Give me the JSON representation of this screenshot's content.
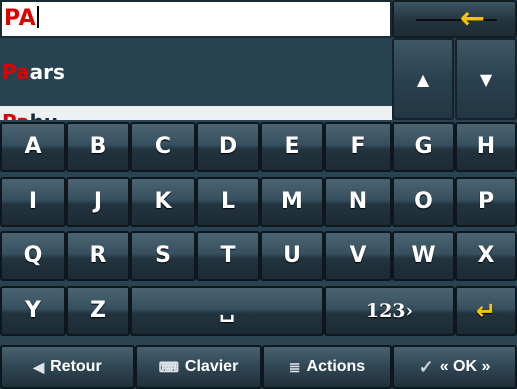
{
  "search": {
    "value": "PA"
  },
  "back_icon": "left-arrow-icon",
  "list": {
    "items": [
      {
        "match": "Pa",
        "rest": "ars",
        "selected": true
      },
      {
        "match": "Pa",
        "rest": "hu",
        "selected": false
      }
    ]
  },
  "nav": {
    "up": "▲",
    "down": "▼"
  },
  "keys": {
    "row1": [
      "A",
      "B",
      "C",
      "D",
      "E",
      "F",
      "G",
      "H"
    ],
    "row2": [
      "I",
      "J",
      "K",
      "L",
      "M",
      "N",
      "O",
      "P"
    ],
    "row3": [
      "Q",
      "R",
      "S",
      "T",
      "U",
      "V",
      "W",
      "X"
    ],
    "row4": [
      "Y",
      "Z"
    ],
    "space_icon": "␣",
    "numbers": "123›",
    "enter_icon": "↵"
  },
  "actions": {
    "back": "Retour",
    "keyboard": "Clavier",
    "actions": "Actions",
    "ok": "« OK »"
  },
  "colors": {
    "highlight": "#e00000",
    "accent": "#f6c400",
    "selected_row": "#274352"
  }
}
